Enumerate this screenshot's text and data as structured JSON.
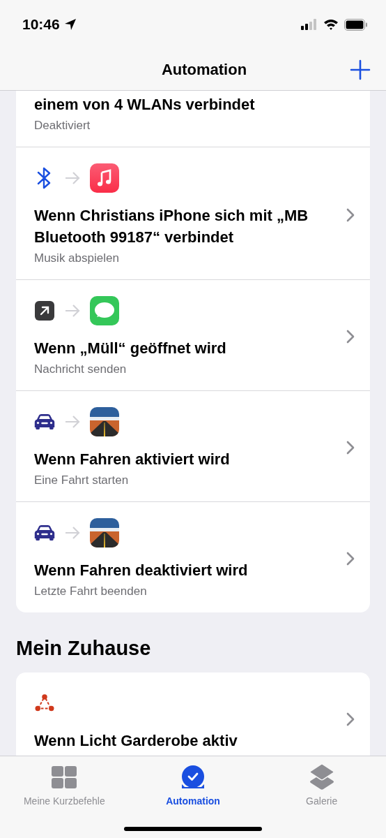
{
  "status_bar": {
    "time": "10:46"
  },
  "nav": {
    "title": "Automation"
  },
  "automations": [
    {
      "title": "einem von 4 WLANs verbindet",
      "subtitle": "Deaktiviert"
    },
    {
      "trigger": {
        "kind": "bluetooth"
      },
      "action": {
        "kind": "music"
      },
      "title": "Wenn Christians iPhone sich mit „MB Bluetooth 99187“ verbindet",
      "subtitle": "Musik abspielen"
    },
    {
      "trigger": {
        "kind": "app"
      },
      "action": {
        "kind": "messages"
      },
      "title": "Wenn „Müll“ geöffnet wird",
      "subtitle": "Nachricht senden"
    },
    {
      "trigger": {
        "kind": "car"
      },
      "action": {
        "kind": "road"
      },
      "title": "Wenn Fahren aktiviert wird",
      "subtitle": "Eine Fahrt starten"
    },
    {
      "trigger": {
        "kind": "car"
      },
      "action": {
        "kind": "road"
      },
      "title": "Wenn Fahren deaktiviert wird",
      "subtitle": "Letzte Fahrt beenden"
    }
  ],
  "home_section": {
    "heading": "Mein Zuhause",
    "automations": [
      {
        "trigger": {
          "kind": "home"
        },
        "title": "Wenn Licht Garderobe aktiv"
      }
    ]
  },
  "tab_bar": [
    {
      "kind": "grid",
      "label": "Meine Kurzbefehle",
      "selected": false
    },
    {
      "kind": "automation",
      "label": "Automation",
      "selected": true
    },
    {
      "kind": "layers",
      "label": "Galerie",
      "selected": false
    }
  ]
}
